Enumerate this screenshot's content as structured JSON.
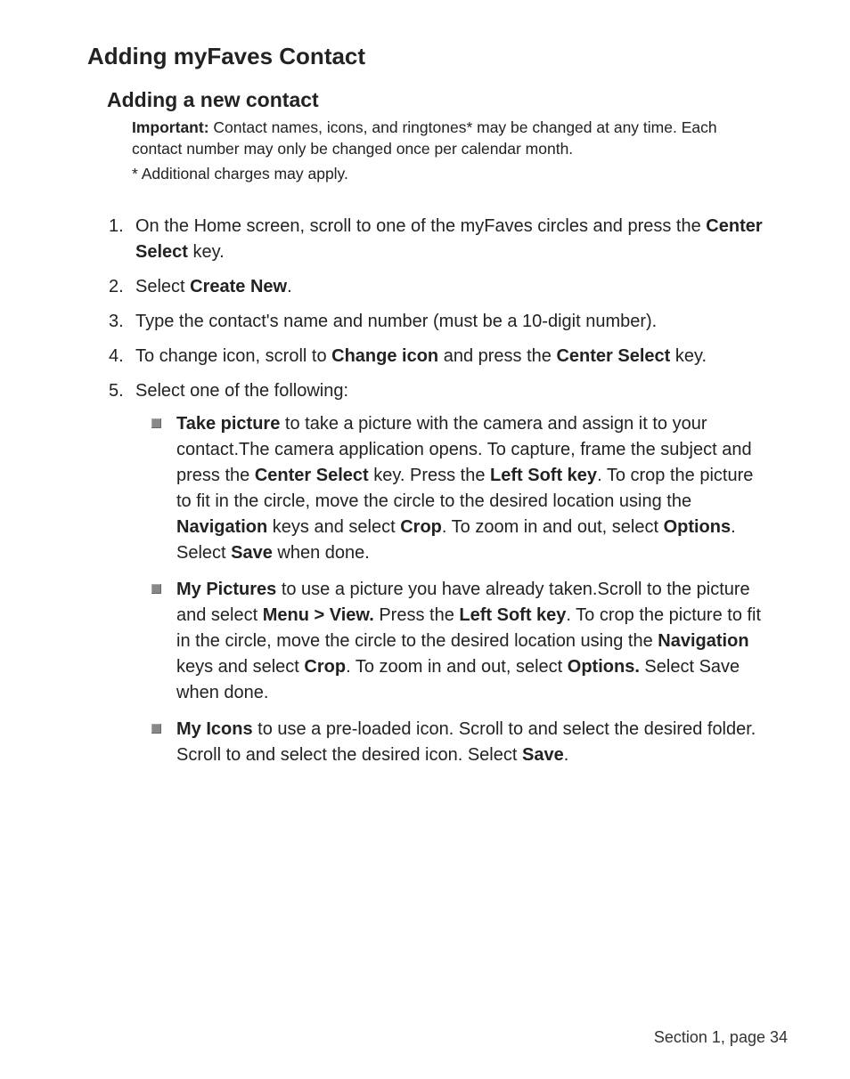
{
  "title": "Adding myFaves Contact",
  "subtitle": "Adding a new contact",
  "importantLabel": "Important:",
  "importantText": " Contact names, icons, and ringtones* may be changed at any time. Each contact number may only be changed once per calendar month.",
  "footnote": "* Additional charges may apply.",
  "steps": {
    "s1a": "On the Home screen, scroll to one of the myFaves circles and press the ",
    "s1b": "Center Select",
    "s1c": " key.",
    "s2a": "Select ",
    "s2b": "Create New",
    "s2c": ".",
    "s3": "Type the contact's name and number (must be a 10-digit number).",
    "s4a": "To change icon, scroll to ",
    "s4b": "Change icon",
    "s4c": " and press the ",
    "s4d": "Center Select",
    "s4e": " key.",
    "s5": "Select one of the following:"
  },
  "sub": {
    "a1": "Take picture",
    "a2": " to take a picture with the camera and assign it to your contact.The camera application opens. To capture, frame the subject and press the ",
    "a3": "Center Select",
    "a4": " key. Press the ",
    "a5": "Left Soft key",
    "a6": ". To crop the picture to fit in the circle, move the circle to the desired location using the ",
    "a7": "Navigation",
    "a8": " keys and select ",
    "a9": "Crop",
    "a10": ". To zoom in and out, select ",
    "a11": "Options",
    "a12": ". Select ",
    "a13": "Save",
    "a14": " when done.",
    "b1": "My Pictures",
    "b2": " to use a picture you have already taken.Scroll to the picture and select ",
    "b3": "Menu > View.",
    "b4": " Press the ",
    "b5": "Left Soft key",
    "b6": ". To crop the picture to fit in the circle, move the circle to the desired location using the ",
    "b7": "Navigation",
    "b8": " keys and select ",
    "b9": "Crop",
    "b10": ". To zoom in and out, select ",
    "b11": "Options.",
    "b12": " Select Save when done.",
    "c1": "My Icons",
    "c2": " to use a pre-loaded icon. Scroll to and select the desired folder. Scroll to and select the desired icon. Select ",
    "c3": "Save",
    "c4": "."
  },
  "footer": "Section 1, page 34"
}
